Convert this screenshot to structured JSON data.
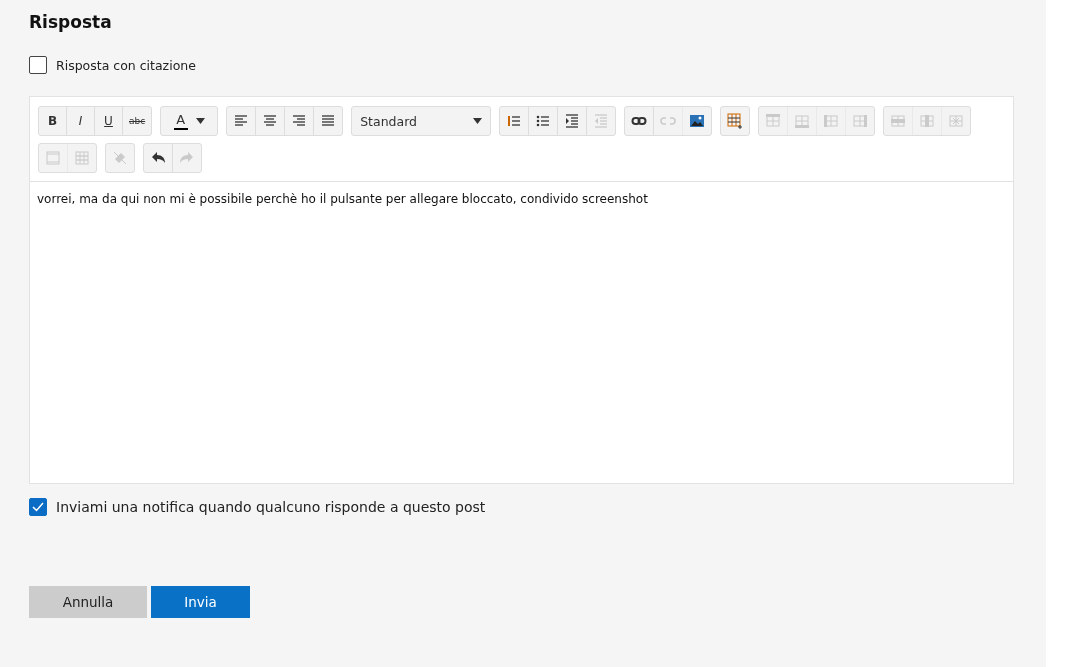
{
  "heading": "Risposta",
  "quote_option": {
    "label": "Risposta con citazione",
    "checked": false
  },
  "editor": {
    "toolbar_rows": [
      [
        {
          "tools": [
            {
              "kind": "text",
              "label": "B"
            },
            {
              "kind": "text",
              "label": "I"
            },
            {
              "kind": "text",
              "label": "U"
            },
            {
              "kind": "text",
              "label": "abc"
            }
          ]
        },
        {
          "tools": [
            {
              "kind": "color",
              "label": "A",
              "color": "#000000"
            }
          ]
        },
        {
          "tools": [
            {
              "kind": "icon",
              "disabled": false
            },
            {
              "kind": "icon",
              "disabled": false
            },
            {
              "kind": "icon",
              "disabled": false
            },
            {
              "kind": "icon",
              "disabled": false
            }
          ]
        },
        {
          "tools": [
            {
              "kind": "select",
              "label": "Standard"
            }
          ]
        },
        {
          "tools": [
            {
              "kind": "icon",
              "disabled": false
            },
            {
              "kind": "icon",
              "disabled": false
            },
            {
              "kind": "icon",
              "disabled": false
            },
            {
              "kind": "icon",
              "disabled": true
            }
          ]
        },
        {
          "tools": [
            {
              "kind": "icon",
              "disabled": false
            },
            {
              "kind": "icon",
              "disabled": true
            },
            {
              "kind": "icon",
              "disabled": false
            }
          ]
        },
        {
          "tools": [
            {
              "kind": "icon",
              "disabled": false
            }
          ]
        },
        {
          "tools": [
            {
              "kind": "icon",
              "disabled": true
            },
            {
              "kind": "icon",
              "disabled": true
            },
            {
              "kind": "icon",
              "disabled": true
            },
            {
              "kind": "icon",
              "disabled": true
            }
          ]
        },
        {
          "tools": [
            {
              "kind": "icon",
              "disabled": true
            },
            {
              "kind": "icon",
              "disabled": true
            },
            {
              "kind": "icon",
              "disabled": true
            }
          ]
        }
      ],
      [
        {
          "tools": [
            {
              "kind": "icon",
              "disabled": true
            },
            {
              "kind": "icon",
              "disabled": true
            }
          ]
        },
        {
          "tools": [
            {
              "kind": "icon",
              "disabled": true
            }
          ]
        },
        {
          "tools": [
            {
              "kind": "icon",
              "disabled": false
            },
            {
              "kind": "icon",
              "disabled": true
            }
          ]
        }
      ]
    ],
    "text": "vorrei, ma da qui non mi è possibile perchè ho il pulsante per allegare bloccato, condivido screenshot"
  },
  "notify_option": {
    "label": "Inviami una notifica quando qualcuno risponde a questo post",
    "checked": true
  },
  "buttons": [
    {
      "label": "Annulla",
      "kind": "secondary"
    },
    {
      "label": "Invia",
      "kind": "primary"
    }
  ]
}
